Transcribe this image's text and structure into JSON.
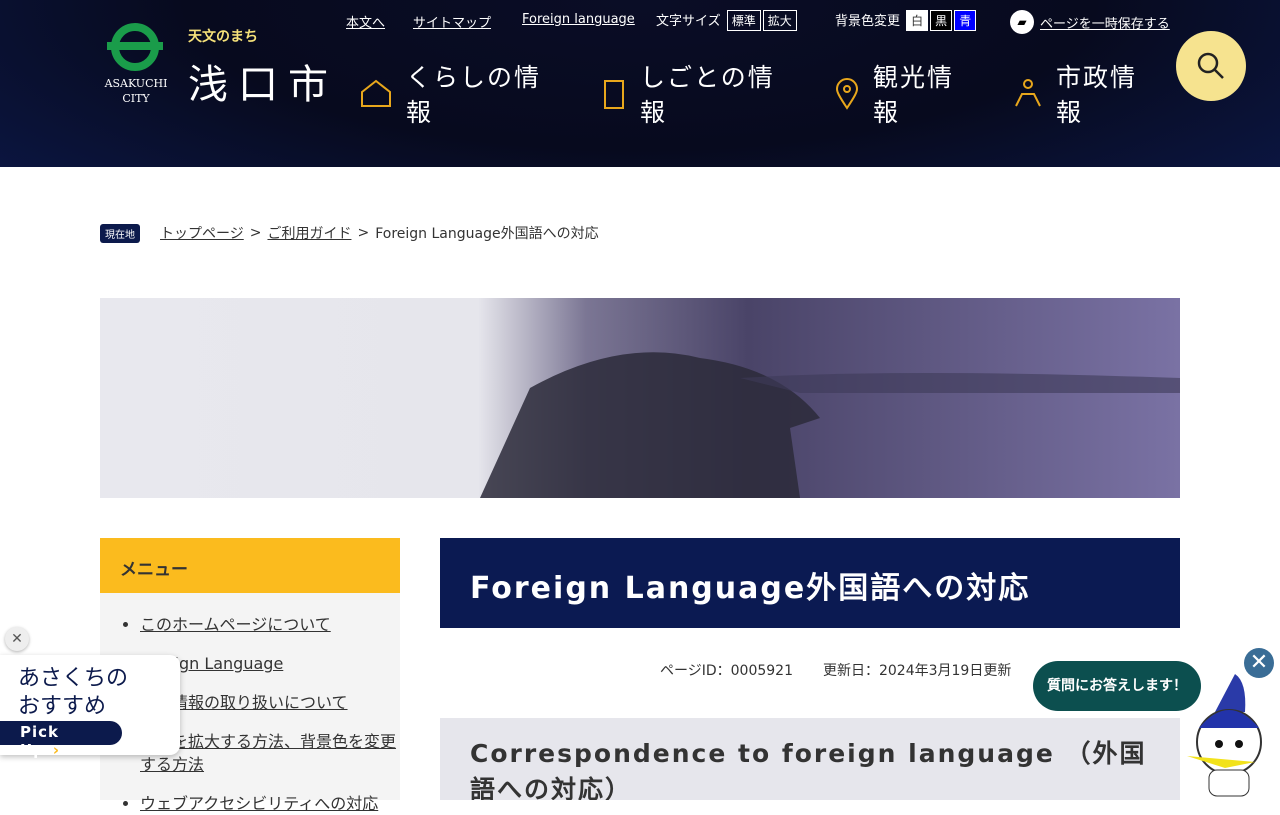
{
  "logo": {
    "tagline": "天文のまち",
    "name": "浅口市",
    "english": "ASAKUCHI CITY"
  },
  "utility": {
    "skip": "本文へ",
    "sitemap": "サイトマップ",
    "foreign": "Foreign language",
    "font_size_label": "文字サイズ",
    "font_standard": "標準",
    "font_large": "拡大",
    "bg_label": "背景色変更",
    "bg_white": "白",
    "bg_black": "黒",
    "bg_blue": "青",
    "save_page": "ページを一時保存する"
  },
  "nav": [
    {
      "label": "くらしの情報"
    },
    {
      "label": "しごとの情報"
    },
    {
      "label": "観光情報"
    },
    {
      "label": "市政情報"
    }
  ],
  "breadcrumb": {
    "here": "現在地",
    "items": [
      "トップページ",
      "ご利用ガイド"
    ],
    "current": "Foreign Language外国語への対応",
    "sep": ">"
  },
  "menu": {
    "title": "メニュー",
    "items": [
      "このホームページについて",
      "Foreign Language",
      "個人情報の取り扱いについて",
      "文字を拡大する方法、背景色を変更する方法",
      "ウェブアクセシビリティへの対応"
    ]
  },
  "page": {
    "title": "Foreign Language外国語への対応",
    "page_id": "ページID：0005921",
    "updated": "更新日：2024年3月19日更新",
    "heading": "Correspondence to foreign language （外国語への対応）"
  },
  "pickup": {
    "title1": "あさくちの",
    "title2": "おすすめ",
    "button": "Pick Up",
    "arrow": "›",
    "close": "✕"
  },
  "chat": {
    "bubble": "質問にお答えします！",
    "close": "✕"
  }
}
